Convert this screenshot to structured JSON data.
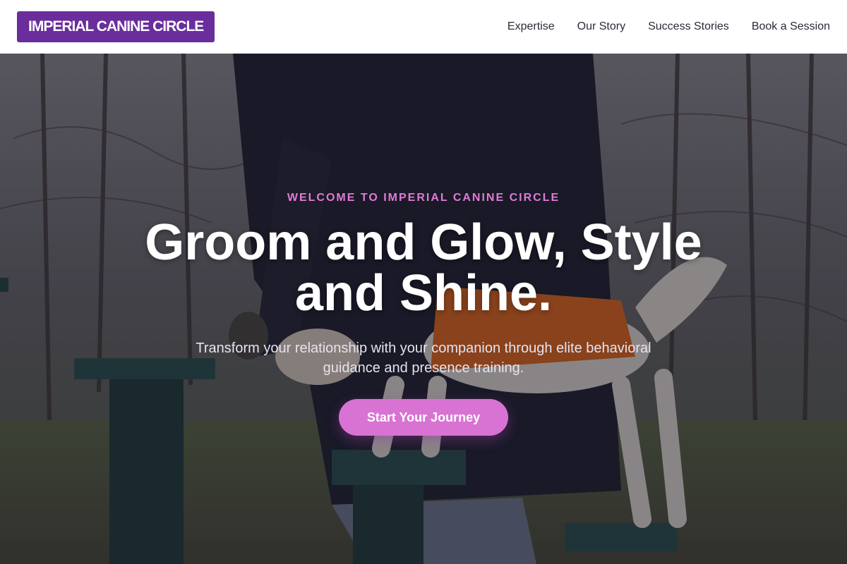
{
  "header": {
    "brand": "IMPERIAL CANINE CIRCLE",
    "nav": [
      {
        "label": "Expertise"
      },
      {
        "label": "Our Story"
      },
      {
        "label": "Success Stories"
      },
      {
        "label": "Book a Session"
      }
    ]
  },
  "hero": {
    "eyebrow": "WELCOME TO IMPERIAL CANINE CIRCLE",
    "headline": "Groom and Glow, Style and Shine.",
    "subtext": "Transform your relationship with your companion through elite behavioral guidance and presence training.",
    "cta_label": "Start Your Journey",
    "image_alt": "person training a dog in an orange jacket on park agility posts"
  },
  "colors": {
    "brand_bg": "#6a2d9c",
    "accent": "#d873d3",
    "eyebrow": "#e07ad6",
    "nav_text": "#2b2b3a"
  }
}
